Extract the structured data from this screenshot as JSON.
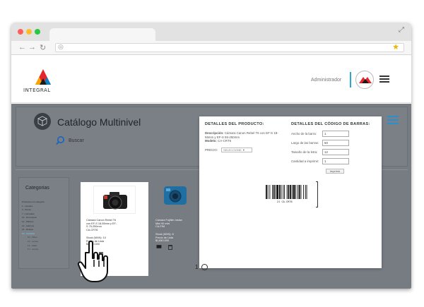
{
  "header": {
    "logo_text": "INTEGRAL",
    "user_label": "Administrador"
  },
  "catalog": {
    "title": "Catálogo Multinivel",
    "search_placeholder": "Buscar"
  },
  "sidebar": {
    "title": "Categorias",
    "items": [
      {
        "label": "Productos por categoria",
        "selected": false,
        "sub": false
      },
      {
        "label": "1 - Camara",
        "selected": false,
        "sub": false
      },
      {
        "label": "4 - Rocas",
        "selected": false,
        "sub": false
      },
      {
        "label": "7 - Lamparas",
        "selected": false,
        "sub": false
      },
      {
        "label": "10 - Decoracion",
        "selected": false,
        "sub": false
      },
      {
        "label": "12 - Platicos",
        "selected": false,
        "sub": false
      },
      {
        "label": "14 - Adornos",
        "selected": false,
        "sub": false
      },
      {
        "label": "21 - Relojes",
        "selected": false,
        "sub": false
      },
      {
        "label": "13 - Camaras",
        "selected": true,
        "sub": false
      },
      {
        "label": "10 - Video",
        "selected": false,
        "sub": true
      },
      {
        "label": "13 - Lentes",
        "selected": false,
        "sub": true
      },
      {
        "label": "14 - Flash",
        "selected": false,
        "sub": true
      },
      {
        "label": "17 - Lentes",
        "selected": false,
        "sub": true
      }
    ]
  },
  "products": [
    {
      "name_lines": [
        "Cámara Canon Rebel T6",
        "con EF-S 18-55mm y EF-",
        "S 75-250mm"
      ],
      "code": "CA-CRT6",
      "stock": "Stock (MXN): 10",
      "price_label": "Precio de Lista",
      "price": "$4,850.000"
    },
    {
      "name_lines": [
        "Cámara Fujifilm Instax",
        "Mini 90 mini"
      ],
      "code": "CA-FIM",
      "stock": "Stock (MXN): 8",
      "price_label": "Precio de Lista",
      "price": "$1,840.000"
    }
  ],
  "pager": {
    "page": "1"
  },
  "modal": {
    "product_heading": "DETALLES DEL PRODUCTO:",
    "desc_label": "Descripción:",
    "desc_line1": "Cámara Canon Rebel T6 con EF-S 18-",
    "desc_line2": "55mm y EF-S 55-250mm",
    "model_label": "Modelo:",
    "model": "CA-CRT6",
    "price_label": "PRECIO:",
    "price_select": "SELECCIONE ▼",
    "barcode_heading": "DETALLES DEL CÓDIGO DE BARRAS:",
    "fields": [
      {
        "label": "Ancho de la barra:",
        "value": "1"
      },
      {
        "label": "Largo de las barras:",
        "value": "50"
      },
      {
        "label": "Tamaño de la letra:",
        "value": "12"
      },
      {
        "label": "Cantidad a imprimir:",
        "value": "1"
      }
    ],
    "print_button": "Imprimir",
    "barcode_text": "21 CA-CRT6"
  },
  "colors": {
    "accent_blue": "#2aa6d9",
    "logo_red": "#e3262c",
    "selected_category": "#6fd6ff"
  }
}
